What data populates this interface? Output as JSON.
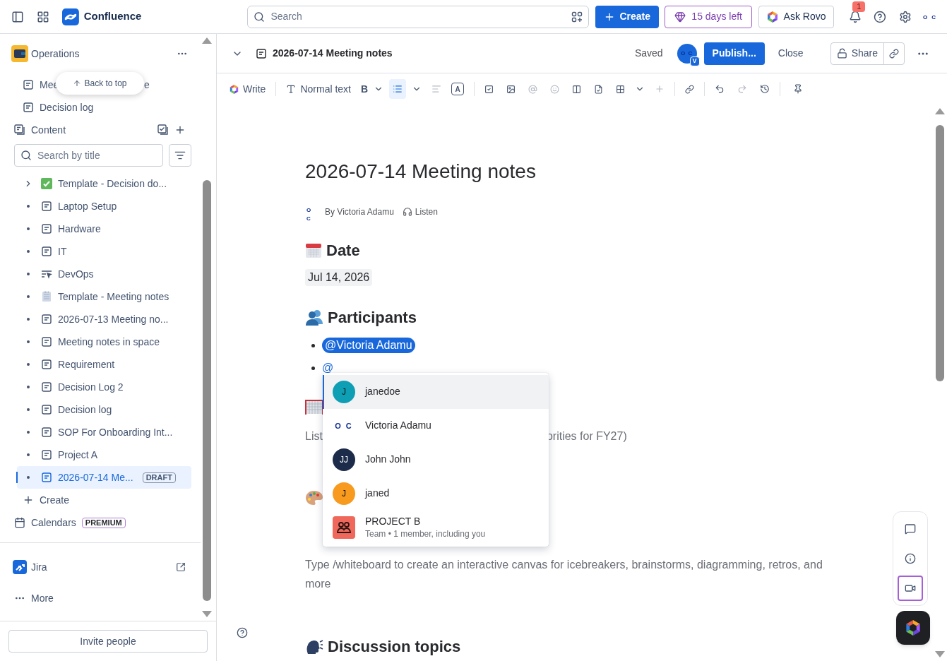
{
  "top_bar": {
    "product": "Confluence",
    "search_placeholder": "Search",
    "create_label": "Create",
    "trial_label": "15 days left",
    "rovo_label": "Ask Rovo",
    "notification_count": "1",
    "avatar_text": "O C"
  },
  "sidebar": {
    "space_name": "Operations",
    "back_to_top": "Back to top",
    "shortcuts": [
      {
        "parts": [
          "Mee",
          "e"
        ]
      },
      {
        "parts": [
          "Decision log"
        ]
      }
    ],
    "content_label": "Content",
    "search_placeholder": "Search by title",
    "tree": [
      {
        "label": "Template - Decision do...",
        "kind": "check",
        "expandable": true,
        "selected": false
      },
      {
        "label": "Laptop Setup",
        "kind": "page",
        "expandable": false,
        "selected": false
      },
      {
        "label": "Hardware",
        "kind": "page",
        "expandable": false,
        "selected": false
      },
      {
        "label": "IT",
        "kind": "page",
        "expandable": false,
        "selected": false
      },
      {
        "label": "DevOps",
        "kind": "live",
        "expandable": false,
        "selected": false
      },
      {
        "label": "Template - Meeting notes",
        "kind": "notepad",
        "expandable": false,
        "selected": false
      },
      {
        "label": "2026-07-13 Meeting no...",
        "kind": "page",
        "expandable": false,
        "selected": false
      },
      {
        "label": "Meeting notes in space",
        "kind": "page",
        "expandable": false,
        "selected": false
      },
      {
        "label": "Requirement",
        "kind": "page",
        "expandable": false,
        "selected": false
      },
      {
        "label": "Decision Log 2",
        "kind": "page",
        "expandable": false,
        "selected": false
      },
      {
        "label": "Decision log",
        "kind": "page",
        "expandable": false,
        "selected": false
      },
      {
        "label": "SOP For Onboarding Int...",
        "kind": "page",
        "expandable": false,
        "selected": false
      },
      {
        "label": "Project A",
        "kind": "page",
        "expandable": false,
        "selected": false
      },
      {
        "label": "2026-07-14 Me...",
        "kind": "page",
        "expandable": false,
        "selected": true,
        "badge": "DRAFT"
      }
    ],
    "create_label": "Create",
    "calendars": {
      "label": "Calendars",
      "badge": "PREMIUM"
    },
    "apps": [
      {
        "label": "Jira"
      }
    ],
    "more_label": "More",
    "invite_label": "Invite people"
  },
  "editor_header": {
    "title": "2026-07-14 Meeting notes",
    "status": "Saved",
    "avatar_text": "O C",
    "avatar_badge": "V",
    "publish_label": "Publish...",
    "close_label": "Close",
    "share_label": "Share"
  },
  "toolbar": {
    "ai_label": "Write",
    "text_style": "Normal text",
    "bold_label": "B",
    "color_label": "A",
    "bullet_list_selected": true
  },
  "document": {
    "title": "2026-07-14 Meeting notes",
    "author_avatar": "O C",
    "byline": "By Victoria Adamu",
    "listen_label": "Listen",
    "blocks": [
      {
        "kind": "heading",
        "emoji": {
          "kind": "calendar"
        },
        "text": "Date"
      },
      {
        "kind": "date",
        "text": "Jul 14, 2026"
      },
      {
        "kind": "heading",
        "emoji": {
          "kind": "people"
        },
        "text": "Participants"
      },
      {
        "kind": "bullets",
        "items": [
          {
            "kind": "mention",
            "text": "@Victoria Adamu"
          },
          {
            "kind": "typing",
            "text": "@"
          }
        ]
      },
      {
        "kind": "heading",
        "emoji": {
          "kind": "goal"
        }
      },
      {
        "kind": "split",
        "parts": [
          "List",
          "orities for FY27)"
        ]
      },
      {
        "kind": "heading",
        "emoji": {
          "kind": "palette"
        }
      },
      {
        "kind": "placeholder",
        "text": "Type /whiteboard to create an interactive canvas for icebreakers, brainstorms, diagramming, retros, and more"
      },
      {
        "kind": "heading",
        "emoji": {
          "kind": "speaker"
        },
        "text": "Discussion topics"
      }
    ]
  },
  "mention_menu": {
    "items": [
      {
        "kind": "user",
        "initial": "J",
        "name": "janedoe",
        "color": "#0e9fb5",
        "selected": true
      },
      {
        "kind": "logo",
        "initial": "O C",
        "name": "Victoria Adamu",
        "selected": false
      },
      {
        "kind": "user",
        "initial": "JJ",
        "name": "John John",
        "color": "#1d2b4a",
        "selected": false
      },
      {
        "kind": "user",
        "initial": "J",
        "name": "janed",
        "color": "#f79a1e",
        "selected": false
      },
      {
        "kind": "team",
        "name": "PROJECT B",
        "subtitle": "Team • 1 member, including you",
        "color": "#f0685c",
        "selected": false
      }
    ]
  },
  "side_actions": {
    "video_selected": true
  }
}
